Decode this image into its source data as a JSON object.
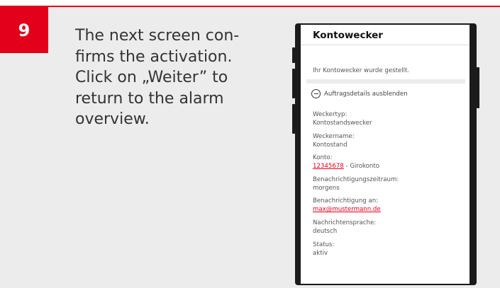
{
  "step": {
    "number": "9"
  },
  "instruction": "The next screen con-\nfirms the activation.\nClick on „Weiter” to\nreturn to the alarm\noverview.",
  "screen": {
    "title": "Kontowecker",
    "confirmation": "Ihr Kontowecker wurde gestellt.",
    "toggle_label": "Auftragsdetails ausblenden",
    "details": {
      "type_label": "Weckertyp:",
      "type_value": "Kontostandswecker",
      "name_label": "Weckername:",
      "name_value": "Kontostand",
      "account_label": "Konto:",
      "account_number": "12345678",
      "account_suffix": " - Girokonto",
      "period_label": "Benachrichtigungszeitraum:",
      "period_value": "morgens",
      "notify_label": "Benachrichtigung an:",
      "notify_value": "max@mustermann.de",
      "lang_label": "Nachrichtensprache:",
      "lang_value": "deutsch",
      "status_label": "Status:",
      "status_value": "aktiv"
    }
  },
  "colors": {
    "accent": "#e2001a",
    "background": "#ececec"
  }
}
